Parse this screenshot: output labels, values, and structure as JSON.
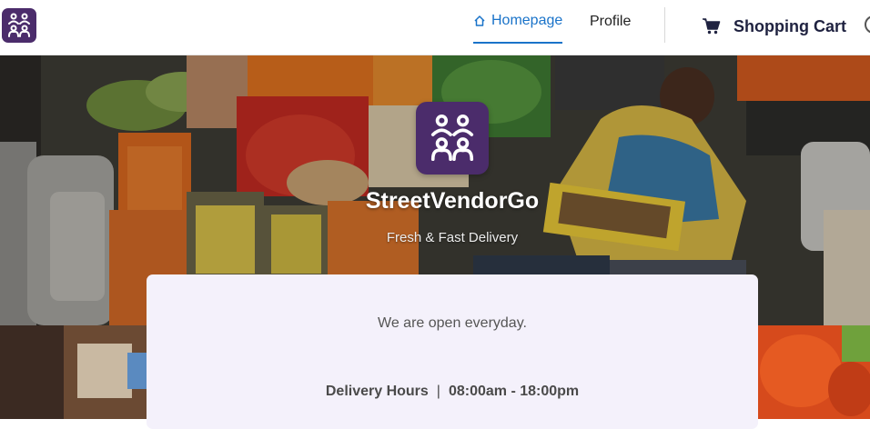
{
  "header": {
    "nav": {
      "home_label": "Homepage",
      "profile_label": "Profile",
      "cart_label": "Shopping Cart"
    }
  },
  "hero": {
    "brand_name": "StreetVendorGo",
    "tagline": "Fresh & Fast Delivery"
  },
  "info": {
    "open_text": "We are open everyday.",
    "hours_label": "Delivery Hours",
    "hours_separator": "|",
    "hours_value": "08:00am - 18:00pm"
  },
  "colors": {
    "brand_purple": "#4b2c6b",
    "nav_active": "#1a73c9",
    "card_bg": "#f4f1fb"
  },
  "icons": [
    "people-group-icon",
    "home-icon",
    "shopping-cart-icon"
  ]
}
